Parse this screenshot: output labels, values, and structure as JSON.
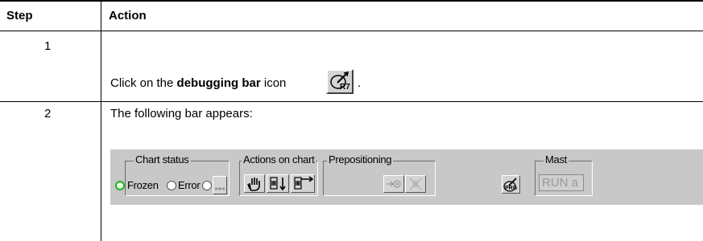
{
  "table": {
    "headers": {
      "step": "Step",
      "action": "Action"
    },
    "rows": [
      {
        "step": "1",
        "action_prefix": "Click on the ",
        "action_bold": "debugging bar",
        "action_suffix": " icon",
        "action_end": "."
      },
      {
        "step": "2",
        "action": "The following bar appears:"
      }
    ]
  },
  "debug_bar": {
    "chart_status": {
      "label": "Chart status",
      "frozen": "Frozen",
      "error": "Error"
    },
    "actions_on_chart": {
      "label": "Actions on chart"
    },
    "prepositioning": {
      "label": "Prepositioning"
    },
    "mast": {
      "label": "Mast",
      "value": "RUN a"
    },
    "prg_icon_text": "PRG",
    "debug_icon_text": "R7"
  },
  "colors": {
    "bar_bg": "#c8c8c8",
    "active_radio": "#1fb01f"
  }
}
